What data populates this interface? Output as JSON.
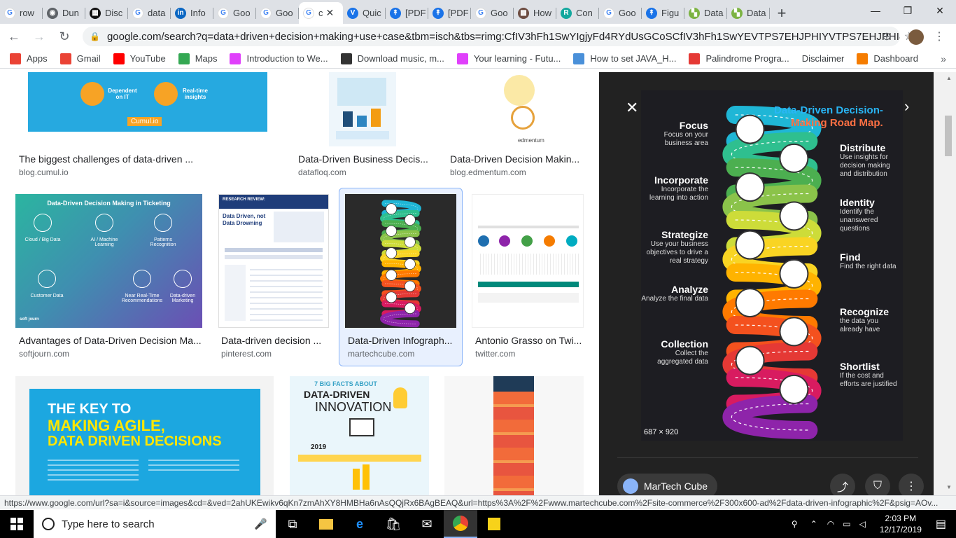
{
  "tabs": [
    {
      "label": "row",
      "color": "#4285f4",
      "glyph": "G"
    },
    {
      "label": "Dun",
      "color": "#5f6368",
      "glyph": "◉"
    },
    {
      "label": "Disc",
      "color": "#111",
      "glyph": "▦"
    },
    {
      "label": "data",
      "color": "#4285f4",
      "glyph": "G"
    },
    {
      "label": "Info",
      "color": "#0a66c2",
      "glyph": "in"
    },
    {
      "label": "Goo",
      "color": "#4285f4",
      "glyph": "G"
    },
    {
      "label": "Goo",
      "color": "#4285f4",
      "glyph": "G"
    },
    {
      "label": "c",
      "color": "#4285f4",
      "glyph": "G"
    },
    {
      "label": "Quic",
      "color": "#1a73e8",
      "glyph": "V"
    },
    {
      "label": "[PDF",
      "color": "#1a73e8",
      "glyph": "↟"
    },
    {
      "label": "[PDF",
      "color": "#1a73e8",
      "glyph": "↟"
    },
    {
      "label": "Goo",
      "color": "#4285f4",
      "glyph": "G"
    },
    {
      "label": "How",
      "color": "#6d4c41",
      "glyph": "▩"
    },
    {
      "label": "Con",
      "color": "#13a89e",
      "glyph": "R"
    },
    {
      "label": "Goo",
      "color": "#4285f4",
      "glyph": "G"
    },
    {
      "label": "Figu",
      "color": "#1a73e8",
      "glyph": "↟"
    },
    {
      "label": "Data",
      "color": "#7cb342",
      "glyph": "▚"
    },
    {
      "label": "Data",
      "color": "#7cb342",
      "glyph": "▚"
    }
  ],
  "omnibox": {
    "url": "google.com/search?q=data+driven+decision+making+use+case&tbm=isch&tbs=rimg:CfIV3hFh1SwYIgjyFd4RYdUsGCoSCfIV3hFh1SwYEVTPS7EHJPHIYVTPS7EHJPHI&tbo=u..."
  },
  "bookmarks": [
    {
      "label": "Apps",
      "color": "#ea4335"
    },
    {
      "label": "Gmail",
      "color": "#ea4335"
    },
    {
      "label": "YouTube",
      "color": "#ff0000"
    },
    {
      "label": "Maps",
      "color": "#34a853"
    },
    {
      "label": "Introduction to We...",
      "color": "#e040fb"
    },
    {
      "label": "Download music, m...",
      "color": "#333"
    },
    {
      "label": "Your learning - Futu...",
      "color": "#e040fb"
    },
    {
      "label": "How to set JAVA_H...",
      "color": "#4a90d9"
    },
    {
      "label": "Palindrome Progra...",
      "color": "#e53935"
    },
    {
      "label": "Disclaimer",
      "color": ""
    },
    {
      "label": "Dashboard",
      "color": "#f57c00"
    }
  ],
  "results": [
    {
      "caption": "The biggest challenges of data-driven ...",
      "source": "blog.cumul.io"
    },
    {
      "caption": "Data-Driven Business Decis...",
      "source": "datafloq.com"
    },
    {
      "caption": "Data-Driven Decision Makin...",
      "source": "blog.edmentum.com"
    },
    {
      "caption": "Advantages of Data-Driven Decision Ma...",
      "source": "softjourn.com"
    },
    {
      "caption": "Data-driven decision ...",
      "source": "pinterest.com"
    },
    {
      "caption": "Data-Driven Infograph...",
      "source": "martechcube.com"
    },
    {
      "caption": "Antonio Grasso on Twi...",
      "source": "twitter.com"
    }
  ],
  "thumb_text": {
    "cumul_a": "Dependent on IT",
    "cumul_b": "Real-time insights",
    "cumul_logo": "Cumul.io",
    "edmentum": "edmentum",
    "softjourn_title": "Data-Driven Decision Making in Ticketing",
    "softjourn_items": [
      "Cloud / Big Data",
      "AI / Machine Learning",
      "Patterns Recognition",
      "Customer Data",
      "Near Real-Time Recommendations",
      "Data-driven Marketing"
    ],
    "softjourn_logo": "soft journ",
    "pin_header": "RESEARCH REVIEW:",
    "pin_title": "Data Driven, not Data Drowning",
    "agile_1": "THE KEY TO",
    "agile_2": "MAKING AGILE,",
    "agile_3": "DATA DRIVEN DECISIONS",
    "innov_1": "7 BIG FACTS ABOUT",
    "innov_2": "DATA-DRIVEN",
    "innov_3": "INNOVATION",
    "innov_year": "2019"
  },
  "panel": {
    "title_1": "Data-Driven Decision-",
    "title_2": "Making Road Map.",
    "dimensions": "687 × 920",
    "site_name": "MarTech Cube",
    "left_steps": [
      {
        "title": "Focus",
        "desc": "Focus on your business area"
      },
      {
        "title": "Incorporate",
        "desc": "Incorporate the learning into action"
      },
      {
        "title": "Strategize",
        "desc": "Use your business objectives to drive a real strategy"
      },
      {
        "title": "Analyze",
        "desc": "Analyze the final data"
      },
      {
        "title": "Collection",
        "desc": "Collect the aggregated data"
      }
    ],
    "right_steps": [
      {
        "title": "Distribute",
        "desc": "Use insights for decision making and distribution"
      },
      {
        "title": "Identity",
        "desc": "Identify the unanswered questions"
      },
      {
        "title": "Find",
        "desc": "Find the right data"
      },
      {
        "title": "Recognize",
        "desc": "the data you already have"
      },
      {
        "title": "Shortlist",
        "desc": "If the cost and efforts are justified"
      }
    ],
    "road_colors": [
      "#1fb6d6",
      "#2fbf8f",
      "#4caf50",
      "#8bc34a",
      "#cddc39",
      "#f9d423",
      "#ffb300",
      "#ff7a00",
      "#f4511e",
      "#e53935",
      "#d81b60",
      "#8e24aa"
    ]
  },
  "status_url": "https://www.google.com/url?sa=i&source=images&cd=&ved=2ahUKEwikv6qKn7zmAhXY8HMBHa6nAsQQjRx6BAgBEAQ&url=https%3A%2F%2Fwww.martechcube.com%2Fsite-commerce%2F300x600-ad%2Fdata-driven-infographic%2F&psig=AOv...",
  "taskbar": {
    "search_placeholder": "Type here to search",
    "time": "2:03 PM",
    "date": "12/17/2019"
  }
}
